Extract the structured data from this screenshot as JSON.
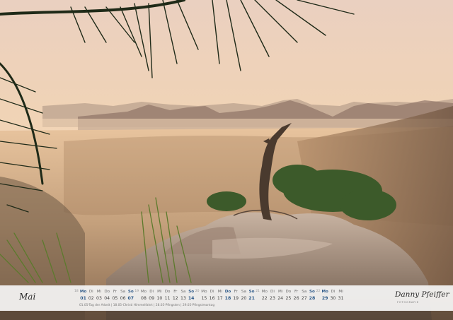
{
  "month": "Mai",
  "weeks": [
    {
      "week": "18",
      "days": [
        {
          "dn": "Mo",
          "d": "01",
          "type": "hol"
        },
        {
          "dn": "Di",
          "d": "02",
          "type": ""
        },
        {
          "dn": "Mi",
          "d": "03",
          "type": ""
        },
        {
          "dn": "Do",
          "d": "04",
          "type": ""
        },
        {
          "dn": "Fr",
          "d": "05",
          "type": ""
        },
        {
          "dn": "Sa",
          "d": "06",
          "type": ""
        },
        {
          "dn": "So",
          "d": "07",
          "type": "sun"
        }
      ]
    },
    {
      "week": "19",
      "days": [
        {
          "dn": "Mo",
          "d": "08",
          "type": ""
        },
        {
          "dn": "Di",
          "d": "09",
          "type": ""
        },
        {
          "dn": "Mi",
          "d": "10",
          "type": ""
        },
        {
          "dn": "Do",
          "d": "11",
          "type": ""
        },
        {
          "dn": "Fr",
          "d": "12",
          "type": ""
        },
        {
          "dn": "Sa",
          "d": "13",
          "type": ""
        },
        {
          "dn": "So",
          "d": "14",
          "type": "sun"
        }
      ]
    },
    {
      "week": "20",
      "days": [
        {
          "dn": "Mo",
          "d": "15",
          "type": ""
        },
        {
          "dn": "Di",
          "d": "16",
          "type": ""
        },
        {
          "dn": "Mi",
          "d": "17",
          "type": ""
        },
        {
          "dn": "Do",
          "d": "18",
          "type": "hol"
        },
        {
          "dn": "Fr",
          "d": "19",
          "type": ""
        },
        {
          "dn": "Sa",
          "d": "20",
          "type": ""
        },
        {
          "dn": "So",
          "d": "21",
          "type": "sun"
        }
      ]
    },
    {
      "week": "21",
      "days": [
        {
          "dn": "Mo",
          "d": "22",
          "type": ""
        },
        {
          "dn": "Di",
          "d": "23",
          "type": ""
        },
        {
          "dn": "Mi",
          "d": "24",
          "type": ""
        },
        {
          "dn": "Do",
          "d": "25",
          "type": ""
        },
        {
          "dn": "Fr",
          "d": "26",
          "type": ""
        },
        {
          "dn": "Sa",
          "d": "27",
          "type": ""
        },
        {
          "dn": "So",
          "d": "28",
          "type": "sun"
        }
      ]
    },
    {
      "week": "22",
      "days": [
        {
          "dn": "Mo",
          "d": "29",
          "type": "hol"
        },
        {
          "dn": "Di",
          "d": "30",
          "type": ""
        },
        {
          "dn": "Mi",
          "d": "31",
          "type": ""
        }
      ]
    }
  ],
  "holidays": "01.05-Tag der Arbeit | 18.05-Christi Himmelfahrt | 28.05-Pfingsten | 29.05-Pfingstmontag",
  "brand": {
    "name": "Danny Pfeiffer",
    "sub": "FOTOGRAFIE"
  },
  "colors": {
    "sky_top": "#e7d6cc",
    "sky_glow": "#f6ddb3",
    "haze": "#b89878",
    "accent": "#2f5b8a"
  },
  "icons": [
    "pine-branch-icon",
    "dead-tree-icon",
    "rock-icon"
  ]
}
